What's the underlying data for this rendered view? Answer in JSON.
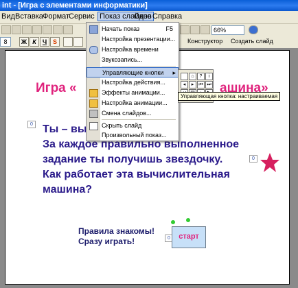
{
  "window": {
    "title": "int - [Игра с элементами информатики]"
  },
  "menubar": {
    "items": [
      {
        "label": "Вид"
      },
      {
        "label": "Вставка"
      },
      {
        "label": "Формат"
      },
      {
        "label": "Сервис"
      },
      {
        "label": "Показ слайдов"
      },
      {
        "label": "Окно"
      },
      {
        "label": "Справка"
      }
    ]
  },
  "toolbar": {
    "zoom": "66%",
    "font_size": "8",
    "bold": "Ж",
    "italic": "К",
    "underline": "Ч",
    "shadow": "S",
    "constructor": "Конструктор",
    "create_slide": "Создать слайд"
  },
  "dropdown": {
    "items": [
      {
        "label": "Начать показ",
        "shortcut": "F5"
      },
      {
        "label": "Настройка презентации..."
      },
      {
        "label": "Настройка времени"
      },
      {
        "label": "Звукозапись..."
      },
      {
        "label": "Управляющие кнопки"
      },
      {
        "label": "Настройка действия..."
      },
      {
        "label": "Эффекты анимации..."
      },
      {
        "label": "Настройка анимации..."
      },
      {
        "label": "Смена слайдов..."
      },
      {
        "label": "Скрыть слайд"
      },
      {
        "label": "Произвольный показ..."
      }
    ]
  },
  "tooltip": "Управляющая кнопка: настраиваемая",
  "slide": {
    "title_left": "Игра «",
    "title_right": "ашина»",
    "marker0": "0",
    "marker1": "0",
    "marker2": "0",
    "body": [
      "Ты – вы             ая машина.",
      "За каждое правильно выполненное",
      "задание ты получишь звездочку.",
      "Как работает эта вычислительная",
      "машина?"
    ],
    "rules_line1": "Правила знакомы!",
    "rules_line2": "Сразу играть!",
    "start_button": "старт"
  },
  "colors": {
    "title": "#e0237d",
    "body": "#2a1a8a",
    "star": "#d6205f",
    "menu_highlight": "#c1d2ee"
  }
}
